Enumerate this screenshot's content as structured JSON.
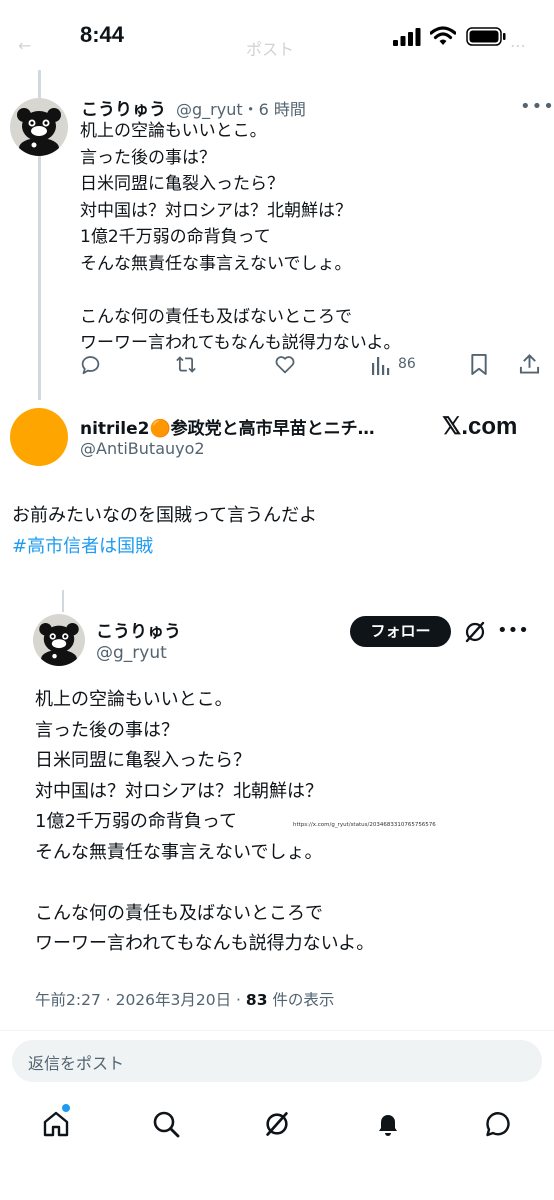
{
  "status_bar": {
    "time": "8:44",
    "faded_title": "ポスト",
    "faded_back": "←"
  },
  "post1": {
    "name": "こうりゅう",
    "handle": "@g_ryut・6 時間",
    "body": "机上の空論もいいとこ。\n言った後の事は？\n日米同盟に亀裂入ったら？\n対中国は？対ロシアは？北朝鮮は？\n1億2千万弱の命背負って\nそんな無責任な事言えないでしょ。\n\nこんな何の責任も及ばないところで\nワーワー言われてもなんも説得力ないよ。",
    "more": "•••",
    "views": "86"
  },
  "card": {
    "name": "nitrile2🟠参政党と高市早苗とニチ…",
    "handle": "@AntiButauyo2",
    "brand": "𝕏.com",
    "reply_text": "お前みたいなのを国賊って言うんだよ",
    "hashtag": "#高市信者は国賊"
  },
  "quote": {
    "name": "こうりゅう",
    "handle": "@g_ryut",
    "follow_label": "フォロー",
    "more": "•••",
    "body": "机上の空論もいいとこ。\n言った後の事は？\n日米同盟に亀裂入ったら？\n対中国は？対ロシアは？北朝鮮は？\n1億2千万弱の命背負って\nそんな無責任な事言えないでしょ。\n\nこんな何の責任も及ばないところで\nワーワー言われてもなんも説得力ないよ。",
    "url": "https://x.com/g_ryut/status/2034683310765756576",
    "meta_prefix": "午前2:27 · 2026年3月20日 · ",
    "view_count": "83",
    "view_suffix": " 件の表示"
  },
  "reply_placeholder": "返信をポスト",
  "colors": {
    "accent": "#1d9bf0",
    "orange": "#ffa500",
    "text": "#0f1419",
    "muted": "#536471"
  }
}
